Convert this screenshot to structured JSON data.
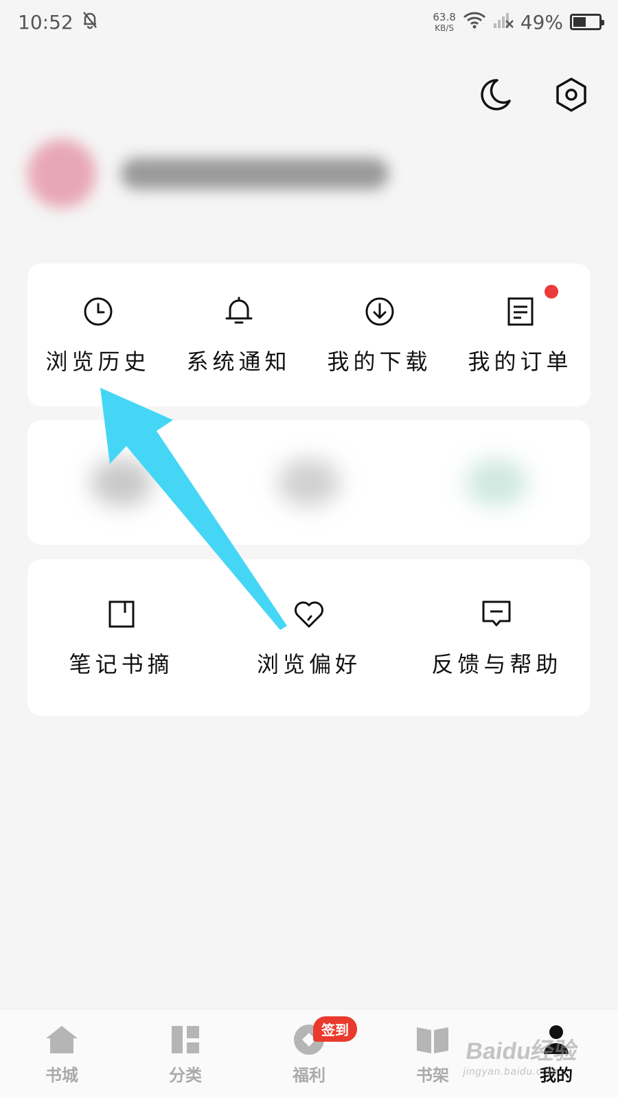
{
  "status_bar": {
    "time": "10:52",
    "net_speed": "63.8",
    "net_unit": "KB/S",
    "battery": "49%",
    "battery_level": 0.49
  },
  "top_actions": {
    "night_mode_icon": "moon-icon",
    "settings_icon": "hexagon-gear-icon"
  },
  "quick_menu": [
    {
      "label": "浏览历史",
      "icon": "clock-icon"
    },
    {
      "label": "系统通知",
      "icon": "bell-icon"
    },
    {
      "label": "我的下载",
      "icon": "download-icon"
    },
    {
      "label": "我的订单",
      "icon": "order-icon",
      "has_dot": true
    }
  ],
  "tools_menu": [
    {
      "label": "笔记书摘",
      "icon": "bookmark-icon"
    },
    {
      "label": "浏览偏好",
      "icon": "heart-icon"
    },
    {
      "label": "反馈与帮助",
      "icon": "message-icon"
    }
  ],
  "tabbar": {
    "items": [
      {
        "label": "书城",
        "icon": "home-icon"
      },
      {
        "label": "分类",
        "icon": "grid-icon"
      },
      {
        "label": "福利",
        "icon": "coin-icon",
        "badge": "签到"
      },
      {
        "label": "书架",
        "icon": "book-icon"
      },
      {
        "label": "我的",
        "icon": "user-icon",
        "active": true
      }
    ]
  },
  "watermark": {
    "brand": "Baidu经验",
    "url": "jingyan.baidu.com"
  },
  "colors": {
    "accent_red": "#ea3a2e",
    "arrow": "#45d6f5",
    "background": "#f5f5f5"
  }
}
